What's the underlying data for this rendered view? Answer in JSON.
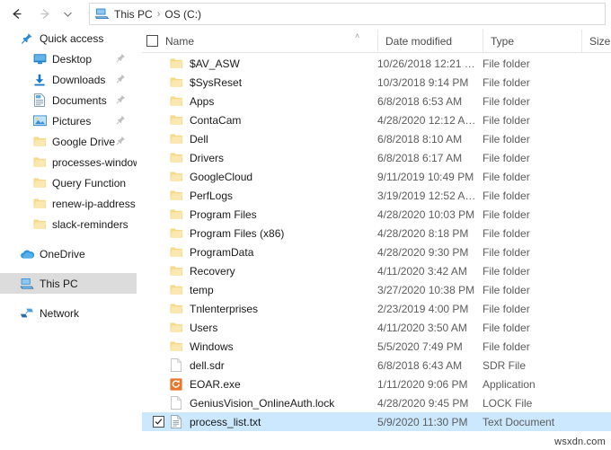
{
  "window": {
    "title": "OS (C:)"
  },
  "nav": {
    "back_icon": "arrow-left-icon",
    "back_enabled": true,
    "forward_icon": "arrow-right-icon",
    "forward_enabled": false,
    "recent_icon": "chevron-down-icon",
    "up_icon": "arrow-up-icon"
  },
  "address_bar": {
    "icon": "this-pc-icon",
    "crumbs": [
      "This PC",
      "OS (C:)"
    ],
    "separator": "›"
  },
  "sidebar": {
    "selected": "This PC",
    "items": [
      {
        "label": "Quick access",
        "icon": "pin-star-icon",
        "indent": false,
        "pinned": false,
        "selected": false
      },
      {
        "label": "Desktop",
        "icon": "desktop-icon",
        "indent": true,
        "pinned": true,
        "selected": false
      },
      {
        "label": "Downloads",
        "icon": "downloads-icon",
        "indent": true,
        "pinned": true,
        "selected": false
      },
      {
        "label": "Documents",
        "icon": "documents-icon",
        "indent": true,
        "pinned": true,
        "selected": false
      },
      {
        "label": "Pictures",
        "icon": "pictures-icon",
        "indent": true,
        "pinned": true,
        "selected": false
      },
      {
        "label": "Google Drive",
        "icon": "folder-icon",
        "indent": true,
        "pinned": true,
        "selected": false
      },
      {
        "label": "processes-windows",
        "icon": "folder-icon",
        "indent": true,
        "pinned": false,
        "selected": false
      },
      {
        "label": "Query Function",
        "icon": "folder-icon",
        "indent": true,
        "pinned": false,
        "selected": false
      },
      {
        "label": "renew-ip-address",
        "icon": "folder-icon",
        "indent": true,
        "pinned": false,
        "selected": false
      },
      {
        "label": "slack-reminders",
        "icon": "folder-icon",
        "indent": true,
        "pinned": false,
        "selected": false
      },
      {
        "label": "OneDrive",
        "icon": "onedrive-icon",
        "indent": false,
        "pinned": false,
        "selected": false,
        "gap_before": true
      },
      {
        "label": "This PC",
        "icon": "this-pc-icon",
        "indent": false,
        "pinned": false,
        "selected": true,
        "gap_before": true
      },
      {
        "label": "Network",
        "icon": "network-icon",
        "indent": false,
        "pinned": false,
        "selected": false,
        "gap_before": true
      }
    ]
  },
  "columns": {
    "select_all_checkbox": false,
    "sort_indicator": "˄",
    "sort_column": "Name",
    "headers": [
      "Name",
      "Date modified",
      "Type",
      "Size"
    ]
  },
  "files": [
    {
      "name": "$AV_ASW",
      "date": "10/26/2018 12:21 …",
      "type": "File folder",
      "size": "",
      "icon": "folder-icon",
      "selected": false
    },
    {
      "name": "$SysReset",
      "date": "10/3/2018 9:14 PM",
      "type": "File folder",
      "size": "",
      "icon": "folder-icon",
      "selected": false
    },
    {
      "name": "Apps",
      "date": "6/8/2018 6:53 AM",
      "type": "File folder",
      "size": "",
      "icon": "folder-icon",
      "selected": false
    },
    {
      "name": "ContaCam",
      "date": "4/28/2020 12:12 A…",
      "type": "File folder",
      "size": "",
      "icon": "folder-icon",
      "selected": false
    },
    {
      "name": "Dell",
      "date": "6/8/2018 8:10 AM",
      "type": "File folder",
      "size": "",
      "icon": "folder-icon",
      "selected": false
    },
    {
      "name": "Drivers",
      "date": "6/8/2018 6:17 AM",
      "type": "File folder",
      "size": "",
      "icon": "folder-icon",
      "selected": false
    },
    {
      "name": "GoogleCloud",
      "date": "9/11/2019 10:49 PM",
      "type": "File folder",
      "size": "",
      "icon": "folder-icon",
      "selected": false
    },
    {
      "name": "PerfLogs",
      "date": "3/19/2019 12:52 A…",
      "type": "File folder",
      "size": "",
      "icon": "folder-icon",
      "selected": false
    },
    {
      "name": "Program Files",
      "date": "4/28/2020 10:03 PM",
      "type": "File folder",
      "size": "",
      "icon": "folder-icon",
      "selected": false
    },
    {
      "name": "Program Files (x86)",
      "date": "4/28/2020 8:18 PM",
      "type": "File folder",
      "size": "",
      "icon": "folder-icon",
      "selected": false
    },
    {
      "name": "ProgramData",
      "date": "4/28/2020 9:30 PM",
      "type": "File folder",
      "size": "",
      "icon": "folder-icon",
      "selected": false
    },
    {
      "name": "Recovery",
      "date": "4/11/2020 3:42 AM",
      "type": "File folder",
      "size": "",
      "icon": "folder-icon",
      "selected": false
    },
    {
      "name": "temp",
      "date": "3/27/2020 10:38 PM",
      "type": "File folder",
      "size": "",
      "icon": "folder-icon",
      "selected": false
    },
    {
      "name": "Tnlenterprises",
      "date": "2/23/2019 4:00 PM",
      "type": "File folder",
      "size": "",
      "icon": "folder-icon",
      "selected": false
    },
    {
      "name": "Users",
      "date": "4/11/2020 3:50 AM",
      "type": "File folder",
      "size": "",
      "icon": "folder-icon",
      "selected": false
    },
    {
      "name": "Windows",
      "date": "5/5/2020 7:49 PM",
      "type": "File folder",
      "size": "",
      "icon": "folder-icon",
      "selected": false
    },
    {
      "name": "dell.sdr",
      "date": "6/8/2018 6:43 AM",
      "type": "SDR File",
      "size": "",
      "icon": "generic-file-icon",
      "selected": false
    },
    {
      "name": "EOAR.exe",
      "date": "1/11/2020 9:06 PM",
      "type": "Application",
      "size": "",
      "icon": "application-icon",
      "selected": false
    },
    {
      "name": "GeniusVision_OnlineAuth.lock",
      "date": "4/28/2020 9:45 PM",
      "type": "LOCK File",
      "size": "",
      "icon": "generic-file-icon",
      "selected": false
    },
    {
      "name": "process_list.txt",
      "date": "5/9/2020 11:30 PM",
      "type": "Text Document",
      "size": "",
      "icon": "text-document-icon",
      "selected": true
    }
  ],
  "watermark": {
    "text": "wsxdn.com"
  },
  "colors": {
    "selection_blue": "#cce8ff",
    "sidebar_selection": "#dcdcdc",
    "folder_yellow": "#f7d98a",
    "accent_orange": "#e8762c"
  }
}
